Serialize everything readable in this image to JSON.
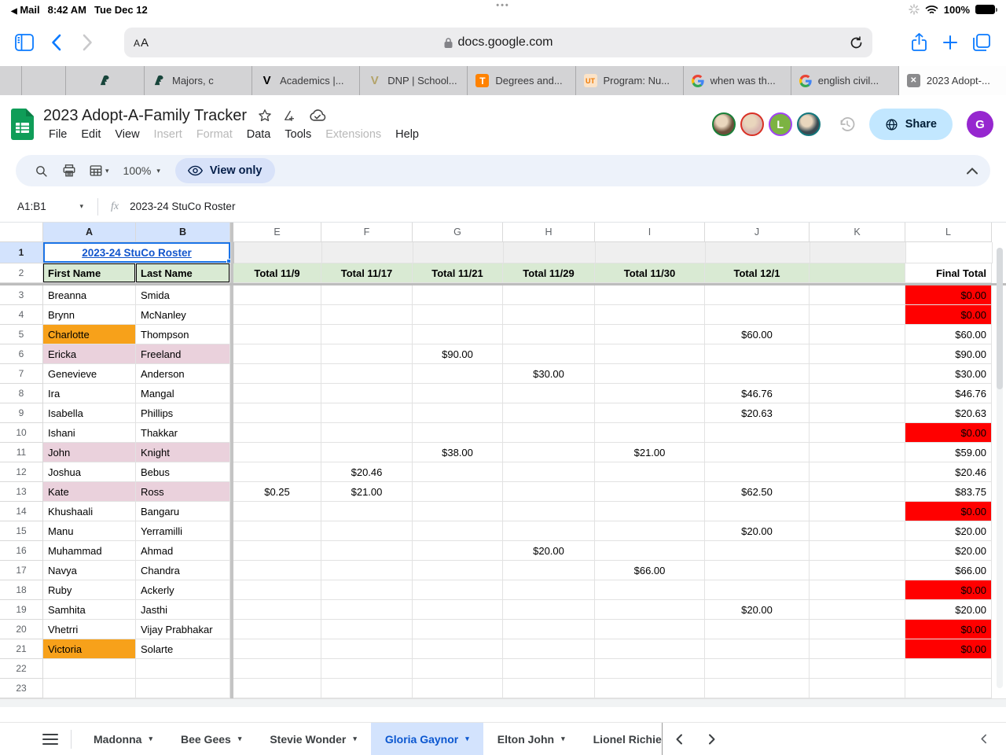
{
  "colors": {
    "orange": "#F7A11A",
    "pink": "#EAD1DC",
    "red": "#FF0000",
    "header_green": "#D9EAD3",
    "row1_gray": "#EFEFEF",
    "link_blue": "#1155CC",
    "accent_blue": "#0B57D0",
    "selection_blue": "#1A73E8",
    "active_tab_bg": "#D3E3FD"
  },
  "status_bar": {
    "back_app": "Mail",
    "time": "8:42 AM",
    "date": "Tue Dec 12",
    "battery": "100%",
    "handle_dots": "•••"
  },
  "browser": {
    "reader_big": "A",
    "reader_small": "A",
    "address": "docs.google.com",
    "tabs": [
      {
        "label": "",
        "icon": "msu-spartan-icon"
      },
      {
        "label": "Majors, c",
        "icon": "msu-spartan-icon"
      },
      {
        "label": "Academics |...",
        "icon": "vanderbilt-v-icon"
      },
      {
        "label": "DNP | School...",
        "icon": "gold-v-icon"
      },
      {
        "label": "Degrees and...",
        "icon": "tennessee-t-icon"
      },
      {
        "label": "Program: Nu...",
        "icon": "ut-icon"
      },
      {
        "label": "when was th...",
        "icon": "google-g-icon"
      },
      {
        "label": "english civil...",
        "icon": "google-g-icon"
      },
      {
        "label": "2023 Adopt-...",
        "icon": "sheets-doc-icon",
        "active": true
      }
    ]
  },
  "app_header": {
    "title": "2023 Adopt-A-Family Tracker",
    "menus": [
      {
        "label": "File"
      },
      {
        "label": "Edit"
      },
      {
        "label": "View"
      },
      {
        "label": "Insert",
        "disabled": true
      },
      {
        "label": "Format",
        "disabled": true
      },
      {
        "label": "Data"
      },
      {
        "label": "Tools"
      },
      {
        "label": "Extensions",
        "disabled": true
      },
      {
        "label": "Help"
      }
    ],
    "collaborators": [
      {
        "initial": "",
        "ring": "#188038",
        "fill": "#6b4f3a"
      },
      {
        "initial": "",
        "ring": "#D93025",
        "fill": "#d8b6b0"
      },
      {
        "initial": "L",
        "ring": "#A142F4",
        "fill": "#7CB342"
      },
      {
        "initial": "",
        "ring": "#12777C",
        "fill": "#3a4a52"
      }
    ],
    "share_label": "Share",
    "profile_initial": "G"
  },
  "toolbar": {
    "zoom_level": "100%",
    "mode_label": "View only"
  },
  "formula_bar": {
    "range": "A1:B1",
    "fx": "fx",
    "value": "2023-24 StuCo Roster"
  },
  "grid": {
    "column_letters": [
      "A",
      "B",
      "E",
      "F",
      "G",
      "H",
      "I",
      "J",
      "K",
      "L"
    ],
    "selected_columns": [
      "A",
      "B"
    ],
    "title_row_number": "1",
    "title_cell_text": "2023-24 StuCo Roster",
    "header_row_number": "2",
    "header_cells": {
      "first": "First Name",
      "last": "Last Name",
      "e": "Total 11/9",
      "f": "Total 11/17",
      "g": "Total 11/21",
      "h": "Total 11/29",
      "i": "Total 11/30",
      "j": "Total 12/1",
      "k": "",
      "l": "Final Total"
    },
    "rows": [
      {
        "n": 3,
        "first": "Breanna",
        "last": "Smida",
        "total": "$0.00",
        "total_red": true
      },
      {
        "n": 4,
        "first": "Brynn",
        "last": "McNanley",
        "total": "$0.00",
        "total_red": true
      },
      {
        "n": 5,
        "first": "Charlotte",
        "first_bg": "orange",
        "last": "Thompson",
        "j": "$60.00",
        "total": "$60.00"
      },
      {
        "n": 6,
        "first": "Ericka",
        "first_bg": "pink",
        "last": "Freeland",
        "last_bg": "pink",
        "g": "$90.00",
        "total": "$90.00"
      },
      {
        "n": 7,
        "first": "Genevieve",
        "last": "Anderson",
        "h": "$30.00",
        "total": "$30.00"
      },
      {
        "n": 8,
        "first": "Ira",
        "last": "Mangal",
        "j": "$46.76",
        "total": "$46.76"
      },
      {
        "n": 9,
        "first": "Isabella",
        "last": "Phillips",
        "j": "$20.63",
        "total": "$20.63"
      },
      {
        "n": 10,
        "first": "Ishani",
        "last": "Thakkar",
        "total": "$0.00",
        "total_red": true
      },
      {
        "n": 11,
        "first": "John",
        "first_bg": "pink",
        "last": "Knight",
        "last_bg": "pink",
        "g": "$38.00",
        "i": "$21.00",
        "total": "$59.00"
      },
      {
        "n": 12,
        "first": "Joshua",
        "last": "Bebus",
        "f": "$20.46",
        "total": "$20.46"
      },
      {
        "n": 13,
        "first": "Kate",
        "first_bg": "pink",
        "last": "Ross",
        "last_bg": "pink",
        "e": "$0.25",
        "f": "$21.00",
        "j": "$62.50",
        "total": "$83.75"
      },
      {
        "n": 14,
        "first": "Khushaali",
        "last": "Bangaru",
        "total": "$0.00",
        "total_red": true
      },
      {
        "n": 15,
        "first": "Manu",
        "last": "Yerramilli",
        "j": "$20.00",
        "total": "$20.00"
      },
      {
        "n": 16,
        "first": "Muhammad",
        "last": "Ahmad",
        "h": "$20.00",
        "total": "$20.00"
      },
      {
        "n": 17,
        "first": "Navya",
        "last": "Chandra",
        "i": "$66.00",
        "total": "$66.00"
      },
      {
        "n": 18,
        "first": "Ruby",
        "last": "Ackerly",
        "total": "$0.00",
        "total_red": true
      },
      {
        "n": 19,
        "first": "Samhita",
        "last": "Jasthi",
        "j": "$20.00",
        "total": "$20.00"
      },
      {
        "n": 20,
        "first": "Vhetrri",
        "last": "Vijay Prabhakar",
        "total": "$0.00",
        "total_red": true
      },
      {
        "n": 21,
        "first": "Victoria",
        "first_bg": "orange",
        "last": "Solarte",
        "total": "$0.00",
        "total_red": true
      },
      {
        "n": 22
      },
      {
        "n": 23
      }
    ]
  },
  "sheet_bar": {
    "tabs": [
      {
        "label": "Madonna"
      },
      {
        "label": "Bee Gees"
      },
      {
        "label": "Stevie Wonder"
      },
      {
        "label": "Gloria Gaynor",
        "active": true
      },
      {
        "label": "Elton John"
      },
      {
        "label": "Lionel Richie",
        "truncated": true
      }
    ]
  }
}
